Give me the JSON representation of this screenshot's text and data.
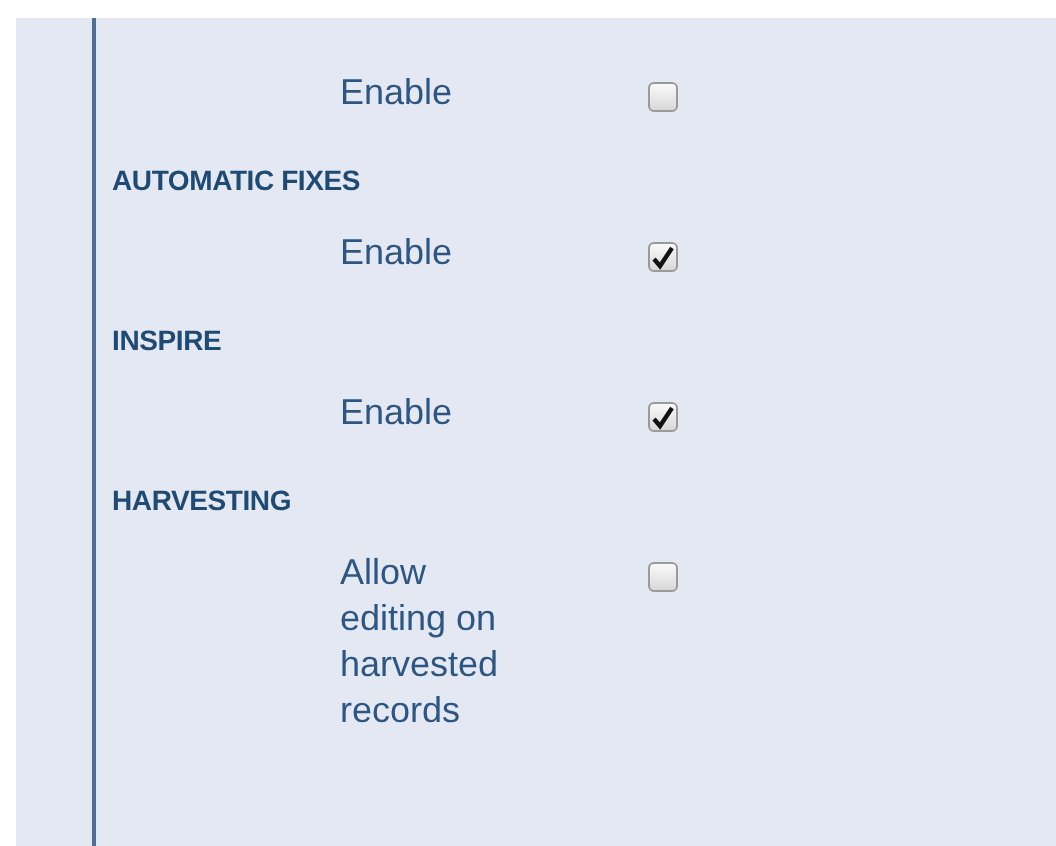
{
  "sections": [
    {
      "options": [
        {
          "label": "Enable",
          "checked": false
        }
      ]
    },
    {
      "heading": "AUTOMATIC FIXES",
      "options": [
        {
          "label": "Enable",
          "checked": true
        }
      ]
    },
    {
      "heading": "INSPIRE",
      "options": [
        {
          "label": "Enable",
          "checked": true
        }
      ]
    },
    {
      "heading": "HARVESTING",
      "options": [
        {
          "label": "Allow editing on harvested records",
          "checked": false
        }
      ]
    }
  ]
}
